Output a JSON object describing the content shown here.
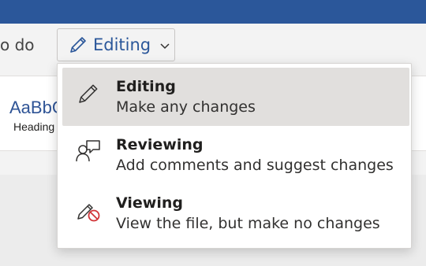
{
  "header": {
    "partial_label": "o do",
    "mode_button_label": "Editing"
  },
  "ribbon": {
    "style_sample": "AaBbC",
    "style_name": "Heading"
  },
  "mode_menu": {
    "items": [
      {
        "title": "Editing",
        "description": "Make any changes",
        "icon": "pencil-icon",
        "selected": true
      },
      {
        "title": "Reviewing",
        "description": "Add comments and suggest changes",
        "icon": "reviewer-comment-icon",
        "selected": false
      },
      {
        "title": "Viewing",
        "description": "View the file, but make no changes",
        "icon": "no-edit-pencil-icon",
        "selected": false
      }
    ]
  },
  "colors": {
    "accent": "#2b579a",
    "selected_bg": "#e1dfdd",
    "prohibited_red": "#d13438"
  }
}
